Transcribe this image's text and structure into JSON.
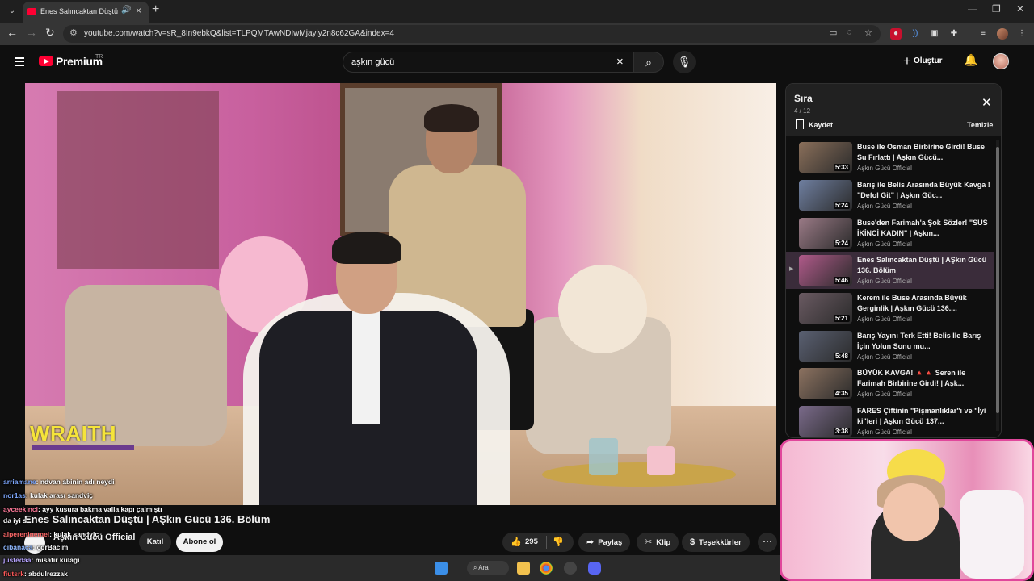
{
  "browser": {
    "tab_title": "Enes Salıncaktan Düştü | AŞkın Gücü 136. Bölüm",
    "url": "youtube.com/watch?v=sR_8In9ebkQ&list=TLPQMTAwNDIwMjayly2n8c62GA&index=4"
  },
  "youtube": {
    "brand": "Premium",
    "country": "TR",
    "search_query": "aşkın gücü",
    "create_label": "Oluştur"
  },
  "video": {
    "title": "Enes Salıncaktan Düştü | AŞkın Gücü 136. Bölüm",
    "channel": "Aşkın Gücü Official",
    "join_label": "Katıl",
    "subscribe_label": "Abone ol",
    "likes": "295",
    "share_label": "Paylaş",
    "clip_label": "Klip",
    "thanks_label": "Teşekkürler",
    "overlay_logo": "WRAITH"
  },
  "playlist": {
    "title": "Sıra",
    "position": "4 / 12",
    "save_label": "Kaydet",
    "clear_label": "Temizle",
    "items": [
      {
        "title": "Buse ile Osman Birbirine Girdi! Buse Su Fırlattı | Aşkın Gücü...",
        "channel": "Aşkın Gücü Official",
        "duration": "5:33",
        "color": "#8a6f5a"
      },
      {
        "title": "Barış ile Belis Arasında Büyük Kavga ! \"Defol Git\" | Aşkın Güc...",
        "channel": "Aşkın Gücü Official",
        "duration": "5:24",
        "color": "#6f7fa0"
      },
      {
        "title": "Buse'den Farimah'a Şok Sözler! \"SUS İKİNCİ KADIN\" | Aşkın...",
        "channel": "Aşkın Gücü Official",
        "duration": "5:24",
        "color": "#9a7a86"
      },
      {
        "title": "Enes Salıncaktan Düştü | AŞkın Gücü 136. Bölüm",
        "channel": "Aşkın Gücü Official",
        "duration": "5:46",
        "color": "#b05a8a"
      },
      {
        "title": "Kerem ile Buse Arasında Büyük Gerginlik | Aşkın Gücü 136....",
        "channel": "Aşkın Gücü Official",
        "duration": "5:21",
        "color": "#6a5a62"
      },
      {
        "title": "Barış Yayını Terk Etti! Belis İle Barış İçin Yolun Sonu mu...",
        "channel": "Aşkın Gücü Official",
        "duration": "5:48",
        "color": "#5a6072"
      },
      {
        "title": "BÜYÜK KAVGA! 🔺🔺 Seren ile Farimah Birbirine Girdi! | Aşk...",
        "channel": "Aşkın Gücü Official",
        "duration": "4:35",
        "color": "#8c7260"
      },
      {
        "title": "FARES Çiftinin \"Pişmanlıklar\"ı ve \"İyi ki\"leri | Aşkın Gücü 137...",
        "channel": "Aşkın Gücü Official",
        "duration": "3:38",
        "color": "#7a6a8a"
      }
    ]
  },
  "chat": [
    {
      "user": "arriamane",
      "msg": ": ndvan abinin adı neydi"
    },
    {
      "user": "nor1as",
      "msg": ": kulak arası sandviç"
    },
    {
      "user": "ayceekinci",
      "msg": ": ayy kusura bakma valla kapı çalmıştı"
    },
    {
      "user": "da iyi s",
      "msg": ""
    },
    {
      "user": "alpereninemei",
      "msg": ": kulak sandviç"
    },
    {
      "user": "cibanaca",
      "msg": ": çorBacım"
    },
    {
      "user": "justedaa",
      "msg": ": misafir kulağı"
    },
    {
      "user": "fiutsrk",
      "msg": ": abdulrezzak"
    }
  ],
  "taskbar": {
    "search_label": "Ara"
  }
}
